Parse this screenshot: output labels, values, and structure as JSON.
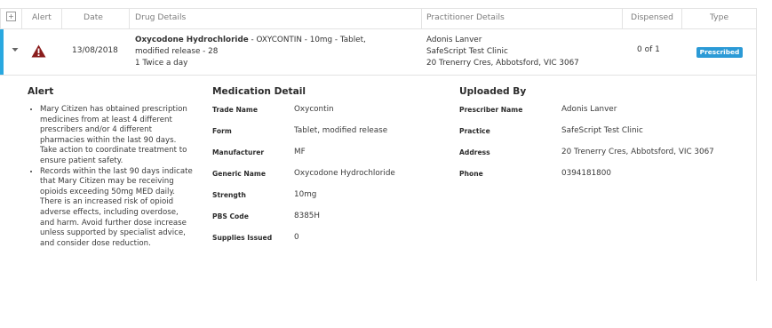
{
  "table": {
    "headers": {
      "alert": "Alert",
      "date": "Date",
      "drug": "Drug Details",
      "practitioner": "Practitioner Details",
      "dispensed": "Dispensed",
      "type": "Type"
    },
    "row": {
      "date": "13/08/2018",
      "drug_name": "Oxycodone Hydrochloride",
      "drug_rest": " - OXYCONTIN - 10mg - Tablet,",
      "drug_line2": "modified release - 28",
      "drug_line3": "1 Twice a day",
      "practitioner_name": "Adonis Lanver",
      "practitioner_clinic": "SafeScript Test Clinic",
      "practitioner_address": "20 Trenerry Cres, Abbotsford, VIC 3067",
      "dispensed": "0 of 1",
      "type_badge": "Prescribed"
    }
  },
  "colors": {
    "accent": "#29a8e0",
    "badge": "#2b9ad6",
    "alert_icon": "#8a1c1c"
  },
  "detail": {
    "alert_title": "Alert",
    "alerts": [
      "Mary Citizen has obtained prescription medicines from at least 4 different prescribers and/or 4 different pharmacies within the last 90 days. Take action to coordinate treatment to ensure patient safety.",
      "Records within the last 90 days indicate that Mary Citizen may be receiving opioids exceeding 50mg MED daily. There is an increased risk of opioid adverse effects, including overdose, and harm. Avoid further dose increase unless supported by specialist advice, and consider dose reduction."
    ],
    "medication_title": "Medication Detail",
    "medication": [
      {
        "label": "Trade Name",
        "value": "Oxycontin"
      },
      {
        "label": "Form",
        "value": "Tablet, modified release"
      },
      {
        "label": "Manufacturer",
        "value": "MF"
      },
      {
        "label": "Generic Name",
        "value": "Oxycodone Hydrochloride"
      },
      {
        "label": "Strength",
        "value": "10mg"
      },
      {
        "label": "PBS Code",
        "value": "8385H"
      },
      {
        "label": "Supplies Issued",
        "value": "0"
      }
    ],
    "uploaded_title": "Uploaded By",
    "uploaded": [
      {
        "label": "Prescriber Name",
        "value": "Adonis Lanver"
      },
      {
        "label": "Practice",
        "value": "SafeScript Test Clinic"
      },
      {
        "label": "Address",
        "value": "20 Trenerry Cres, Abbotsford, VIC 3067"
      },
      {
        "label": "Phone",
        "value": "0394181800"
      }
    ]
  }
}
